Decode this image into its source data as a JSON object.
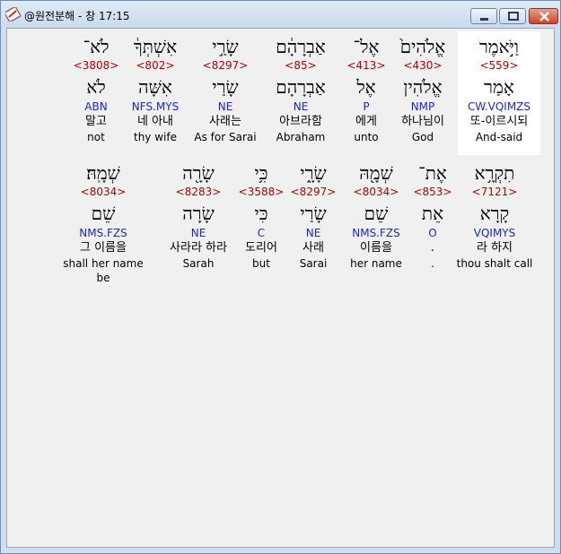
{
  "window": {
    "title": "@원전분해 - 창 17:15",
    "colors": {
      "strong": "#b00000",
      "parse": "#1a28c8",
      "highlight": "#ffffff"
    }
  },
  "rows": [
    {
      "words": [
        {
          "heb": "וַיֹּ֣אמֶר",
          "strong": "<559>",
          "lemma": "אָמַר",
          "parse": "CW.VQIMZS",
          "kor": "또-이르시되",
          "eng": "And-said",
          "highlighted": true
        },
        {
          "heb": "אֱלֹהִים֙",
          "strong": "<430>",
          "lemma": "אֱלֹהִין",
          "parse": "NMP",
          "kor": "하나님이",
          "eng": "God"
        },
        {
          "heb": "אֶל־",
          "strong": "<413>",
          "lemma": "אֶל",
          "parse": "P",
          "kor": "에게",
          "eng": "unto"
        },
        {
          "heb": "אַבְרָהָ֔ם",
          "strong": "<85>",
          "lemma": "אַבְרָהָם",
          "parse": "NE",
          "kor": "아브라함",
          "eng": "Abraham"
        },
        {
          "heb": "שָׂרַ֣י",
          "strong": "<8297>",
          "lemma": "שָׂרַי",
          "parse": "NE",
          "kor": "사래는",
          "eng": "As for Sarai"
        },
        {
          "heb": "אִשְׁתְּךָ֔",
          "strong": "<802>",
          "lemma": "אִשָּׁה",
          "parse": "NFS.MYS",
          "kor": "네 아내",
          "eng": "thy wife"
        },
        {
          "heb": "לֹא־",
          "strong": "<3808>",
          "lemma": "לֹא",
          "parse": "ABN",
          "kor": "말고",
          "eng": "not"
        }
      ]
    },
    {
      "words": [
        {
          "heb": "תִקְרָ֥א",
          "strong": "<7121>",
          "lemma": "קָרָא",
          "parse": "VQIMYS",
          "kor": "라 하지",
          "eng": "thou shalt call"
        },
        {
          "heb": "אֶת־",
          "strong": "<853>",
          "lemma": "אֵת",
          "parse": "O",
          "kor": ".",
          "eng": "."
        },
        {
          "heb": "שְׁמָ֖הּ",
          "strong": "<8034>",
          "lemma": "שֵׁם",
          "parse": "NMS.FZS",
          "kor": "이름을",
          "eng": "her name"
        },
        {
          "heb": "שָׂרָ֑י",
          "strong": "<8297>",
          "lemma": "שָׂרַי",
          "parse": "NE",
          "kor": "사래",
          "eng": "Sarai"
        },
        {
          "heb": "כִּ֥י",
          "strong": "<3588>",
          "lemma": "כִּי",
          "parse": "C",
          "kor": "도리어",
          "eng": "but"
        },
        {
          "heb": "שָׂרָ֖ה",
          "strong": "<8283>",
          "lemma": "שָׂרָה",
          "parse": "NE",
          "kor": "사라라 하라",
          "eng": "Sarah"
        },
        {
          "heb": "שְׁמָֽהּ׃",
          "strong": "<8034>",
          "lemma": "שֵׁם",
          "parse": "NMS.FZS",
          "kor": "그 이름을",
          "eng": "shall her name be"
        }
      ]
    }
  ]
}
